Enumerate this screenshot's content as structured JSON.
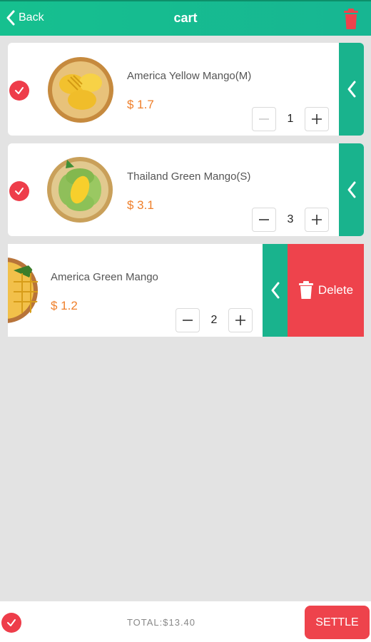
{
  "header": {
    "back_label": "Back",
    "title": "cart",
    "back_icon": "chevron-left-icon",
    "trash_icon": "trash-icon"
  },
  "items": [
    {
      "name": "America Yellow Mango(M)",
      "price": "$ 1.7",
      "qty": "1",
      "checked": true
    },
    {
      "name": "Thailand Green Mango(S)",
      "price": "$ 3.1",
      "qty": "3",
      "checked": true
    },
    {
      "name": "America Green Mango",
      "price": "$ 1.2",
      "qty": "2",
      "checked": false,
      "swiped": true
    }
  ],
  "swipe": {
    "delete_label": "Delete"
  },
  "footer": {
    "total": "TOTAL:$13.40",
    "settle_label": "SETTLE"
  },
  "colors": {
    "header_green": "#16c08f",
    "tab_green": "#19b38d",
    "red": "#ee434c",
    "price_orange": "#ef7f2a",
    "background": "#e3e3e3"
  }
}
